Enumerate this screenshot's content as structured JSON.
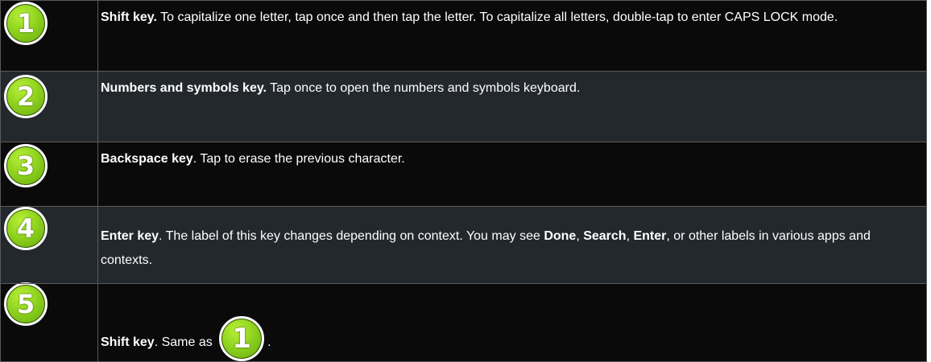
{
  "rows": [
    {
      "number": "1",
      "title": "Shift key.",
      "text": " To capitalize one letter, tap once and then tap the letter. To capitalize all letters, double-tap to enter CAPS LOCK mode."
    },
    {
      "number": "2",
      "title": "Numbers and symbols key.",
      "text": " Tap once to open the numbers and symbols keyboard."
    },
    {
      "number": "3",
      "title": "Backspace key",
      "text": ". Tap to erase the previous character."
    },
    {
      "number": "4",
      "title": "Enter key",
      "text_a": ". The label of this key changes depending on context. You may see ",
      "done": "Done",
      "sep1": ", ",
      "search": "Search",
      "sep2": ", ",
      "enter": "Enter",
      "text_b": ", or other labels in various apps and contexts."
    },
    {
      "number": "5",
      "title": "Shift key",
      "text": ". Same as ",
      "ref_number": "1",
      "end": "."
    }
  ],
  "colors": {
    "badge_green": "#8fd31e",
    "row_dark": "#0a0a0a",
    "row_light": "#23282d",
    "text": "#ffffff"
  },
  "icons": [
    "number-badge-icon"
  ]
}
